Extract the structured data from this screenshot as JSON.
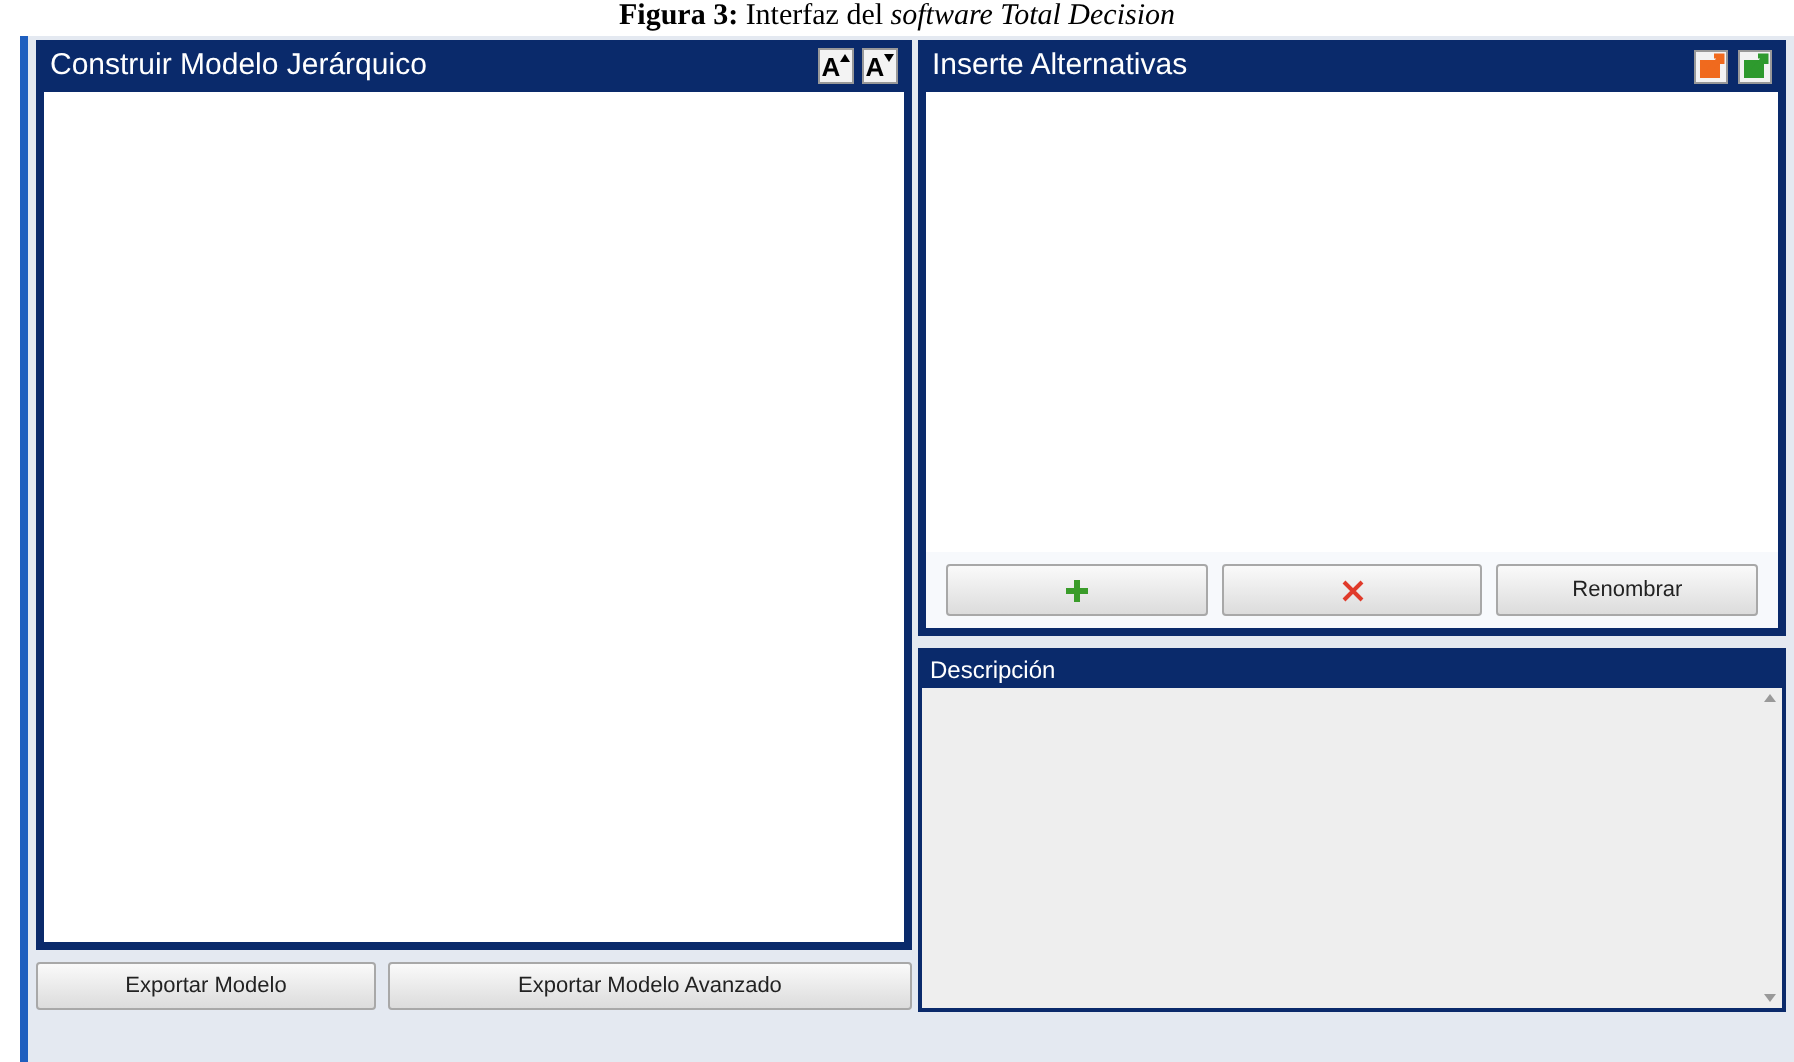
{
  "caption": "**Figura 3:** Interfaz del *software Total Decision*",
  "model_panel": {
    "title": "Construir Modelo Jerárquico",
    "font_buttons": [
      {
        "label": "A",
        "kind": "increase"
      },
      {
        "label": "A",
        "kind": "decrease"
      }
    ],
    "buttons": [
      "Exportar Modelo",
      "Exportar Modelo Avanzado"
    ]
  },
  "alternatives_panel": {
    "title": "Inserte Alternativas",
    "buttons": [
      {
        "kind": "add"
      },
      {
        "kind": "delete"
      },
      {
        "kind": "text",
        "label": "Renombrar"
      }
    ]
  },
  "description_panel": {
    "title": "Descripción"
  }
}
